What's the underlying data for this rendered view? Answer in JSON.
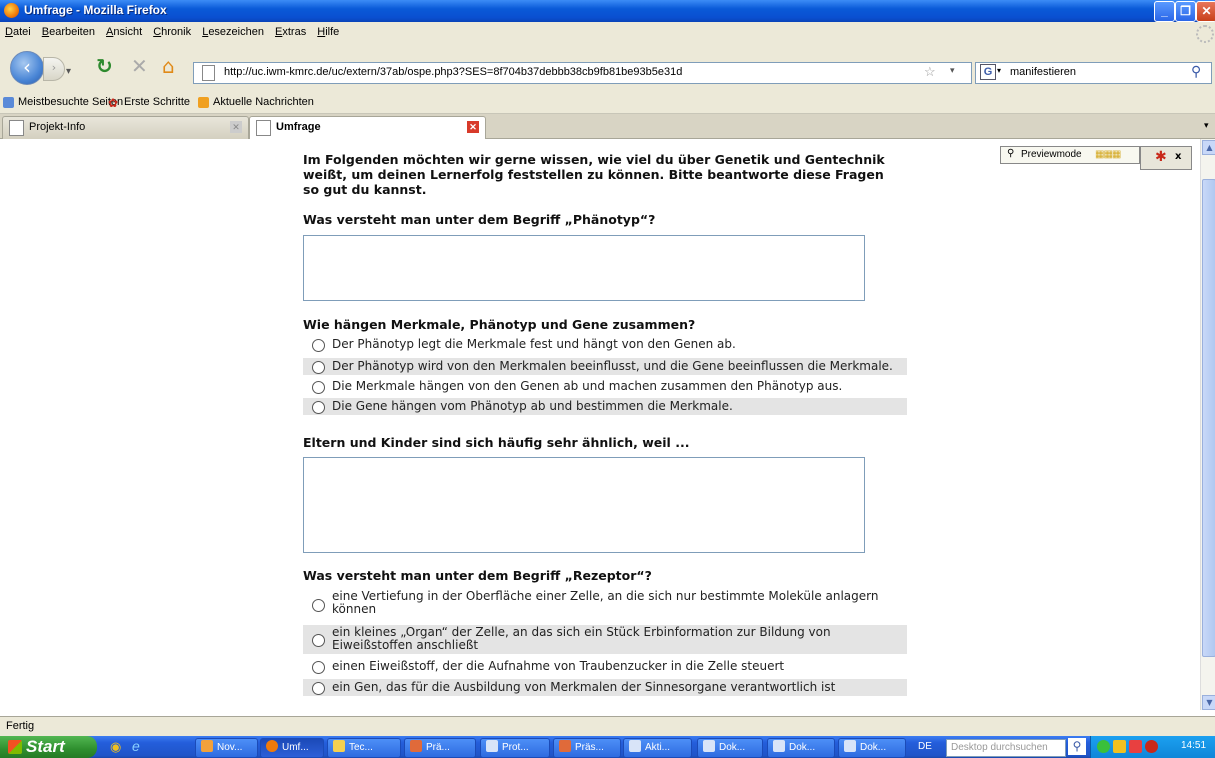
{
  "window": {
    "title": "Umfrage - Mozilla Firefox"
  },
  "menu": [
    "Datei",
    "Bearbeiten",
    "Ansicht",
    "Chronik",
    "Lesezeichen",
    "Extras",
    "Hilfe"
  ],
  "nav": {
    "url": "http://uc.iwm-kmrc.de/uc/extern/37ab/ospe.php3?SES=8f704b37debbb38cb9fb81be93b5e31d",
    "search_value": "manifestieren"
  },
  "bookmarks": [
    "Meistbesuchte Seiten",
    "Erste Schritte",
    "Aktuelle Nachrichten"
  ],
  "tabs": [
    {
      "label": "Projekt-Info",
      "active": false
    },
    {
      "label": "Umfrage",
      "active": true
    }
  ],
  "preview": {
    "label": "Previewmode"
  },
  "survey": {
    "intro": "Im Folgenden möchten wir gerne wissen, wie viel du über Genetik und Gentechnik weißt, um deinen Lernerfolg feststellen zu können. Bitte beantworte diese Fragen so gut du kannst.",
    "q1": "Was versteht man unter dem Begriff „Phänotyp“?",
    "q2": "Wie hängen Merkmale, Phänotyp und Gene zusammen?",
    "q2_options": [
      "Der Phänotyp legt die Merkmale fest und hängt von den Genen ab.",
      "Der Phänotyp wird von den Merkmalen beeinflusst, und die Gene beeinflussen die Merkmale.",
      "Die Merkmale hängen von den Genen ab und machen zusammen den Phänotyp aus.",
      "Die Gene hängen vom Phänotyp ab und bestimmen die Merkmale."
    ],
    "q3": "Eltern und Kinder sind sich häufig sehr ähnlich, weil ...",
    "q4": "Was versteht man unter dem Begriff „Rezeptor“?",
    "q4_options": [
      [
        "eine Vertiefung in der Oberfläche einer Zelle, an die sich nur bestimmte Moleküle anlagern",
        "können"
      ],
      [
        "ein kleines „Organ“ der Zelle, an das sich ein Stück Erbinformation zur Bildung von",
        "Eiweißstoffen anschließt"
      ],
      [
        "einen Eiweißstoff, der die Aufnahme von Traubenzucker in die Zelle steuert"
      ],
      [
        "ein Gen, das für die Ausbildung von Merkmalen der Sinnesorgane verantwortlich ist"
      ]
    ]
  },
  "status": "Fertig",
  "taskbar": {
    "start": "Start",
    "buttons": [
      "Nov...",
      "Umf...",
      "Tec...",
      "Prä...",
      "Prot...",
      "Präs...",
      "Akti...",
      "Dok...",
      "Dok...",
      "Dok..."
    ],
    "language": "DE",
    "desktop_search_placeholder": "Desktop durchsuchen",
    "clock": "14:51"
  }
}
